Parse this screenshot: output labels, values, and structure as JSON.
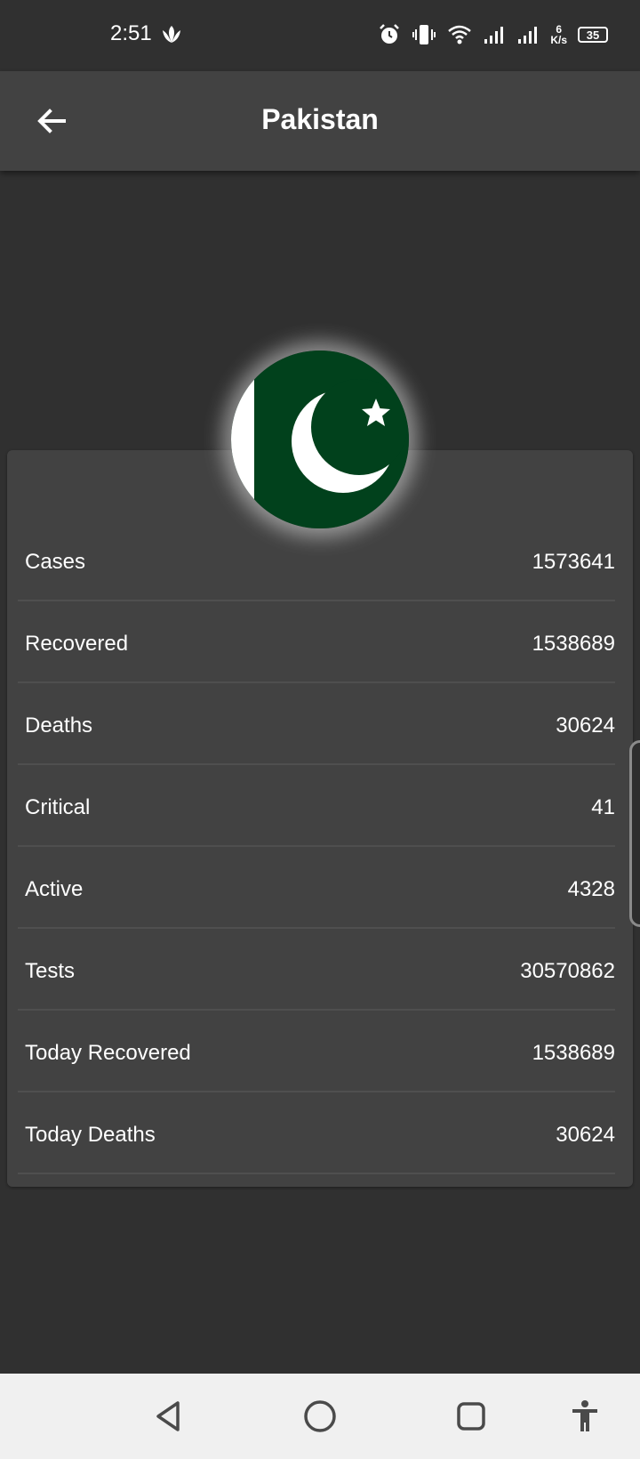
{
  "status_bar": {
    "time": "2:51",
    "net_speed_value": "6",
    "net_speed_unit": "K/s",
    "battery": "35"
  },
  "app_bar": {
    "title": "Pakistan",
    "back_icon": "arrow-back-icon"
  },
  "flag": {
    "country": "Pakistan",
    "colors": {
      "green": "#01411C",
      "white": "#FFFFFF"
    }
  },
  "stats": [
    {
      "label": "Cases",
      "value": "1573641"
    },
    {
      "label": "Recovered",
      "value": "1538689"
    },
    {
      "label": "Deaths",
      "value": "30624"
    },
    {
      "label": "Critical",
      "value": "41"
    },
    {
      "label": "Active",
      "value": "4328"
    },
    {
      "label": "Tests",
      "value": "30570862"
    },
    {
      "label": "Today Recovered",
      "value": "1538689"
    },
    {
      "label": "Today Deaths",
      "value": "30624"
    }
  ],
  "nav_bar": {
    "buttons": [
      "back-triangle-icon",
      "home-circle-icon",
      "recents-square-icon",
      "accessibility-icon"
    ]
  },
  "colors": {
    "background": "#303030",
    "app_bar": "#424242",
    "card": "#424242",
    "text": "#FFFFFF",
    "nav_bar": "#F0F0F0"
  }
}
